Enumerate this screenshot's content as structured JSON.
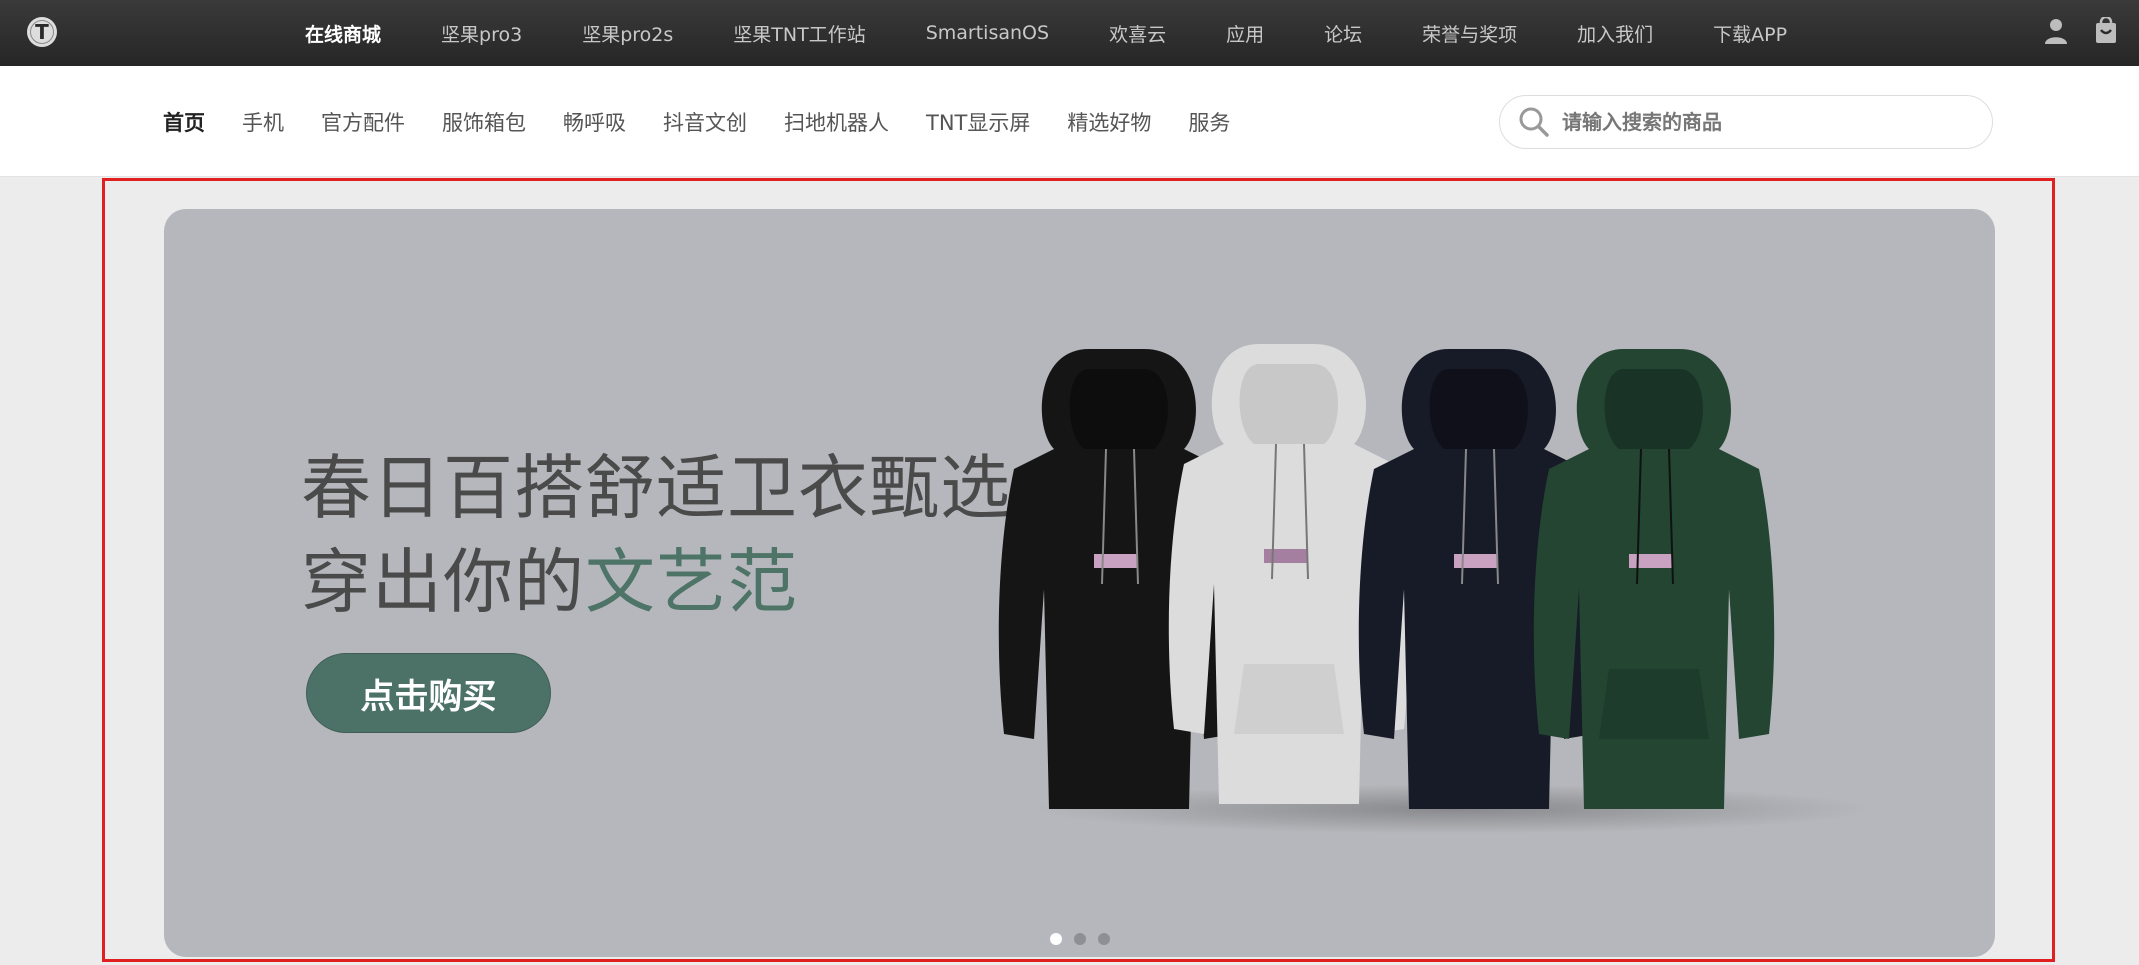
{
  "top_nav": {
    "logo_letter": "T",
    "items": [
      {
        "label": "在线商城",
        "active": true
      },
      {
        "label": "坚果pro3"
      },
      {
        "label": "坚果pro2s"
      },
      {
        "label": "坚果TNT工作站"
      },
      {
        "label": "SmartisanOS"
      },
      {
        "label": "欢喜云"
      },
      {
        "label": "应用"
      },
      {
        "label": "论坛"
      },
      {
        "label": "荣誉与奖项"
      },
      {
        "label": "加入我们"
      },
      {
        "label": "下载APP"
      }
    ],
    "icons": [
      "user-icon",
      "cart-icon"
    ]
  },
  "category_nav": {
    "items": [
      {
        "label": "首页",
        "active": true
      },
      {
        "label": "手机"
      },
      {
        "label": "官方配件"
      },
      {
        "label": "服饰箱包"
      },
      {
        "label": "畅呼吸"
      },
      {
        "label": "抖音文创"
      },
      {
        "label": "扫地机器人"
      },
      {
        "label": "TNT显示屏"
      },
      {
        "label": "精选好物"
      },
      {
        "label": "服务"
      }
    ]
  },
  "search": {
    "placeholder": "请输入搜索的商品",
    "icon": "search-icon"
  },
  "banner": {
    "line1": "春日百搭舒适卫衣甄选",
    "line2_prefix": "穿出你的",
    "line2_accent": "文艺范",
    "button_label": "点击购买",
    "hoodie_colors": [
      "#151515",
      "#dcdcdc",
      "#171a27",
      "#234532"
    ],
    "active_slide": 1,
    "slide_count": 3,
    "accent_color": "#4d7467"
  }
}
